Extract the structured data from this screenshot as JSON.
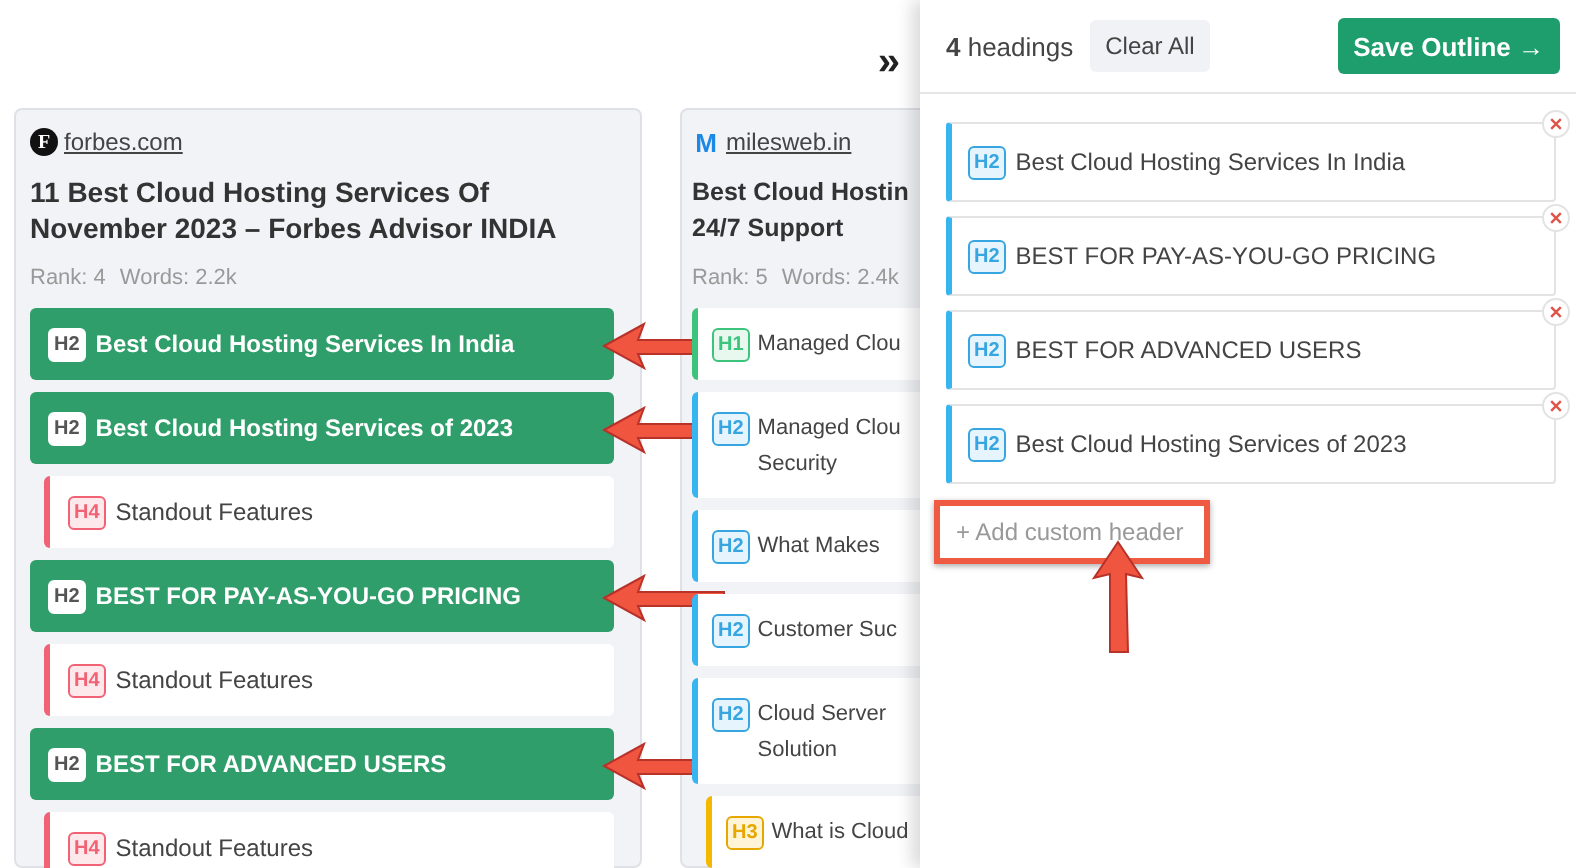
{
  "expand_control": "»",
  "columns": [
    {
      "site": "forbes.com",
      "logo": "F",
      "title": "11 Best Cloud Hosting Services Of November 2023 – Forbes Advisor INDIA",
      "rank": "Rank: 4",
      "words": "Words: 2.2k",
      "headings": [
        {
          "tag": "H2",
          "kind": "h2",
          "lines": [
            "Best Cloud Hosting Services In India"
          ],
          "selected": true,
          "arrow": true
        },
        {
          "tag": "H2",
          "kind": "h2",
          "lines": [
            "Best Cloud Hosting Services of 2023"
          ],
          "selected": true,
          "arrow": true
        },
        {
          "tag": "H4",
          "kind": "h4",
          "lines": [
            "Standout Features"
          ],
          "selected": false,
          "arrow": false
        },
        {
          "tag": "H2",
          "kind": "h2",
          "lines": [
            "BEST FOR PAY-AS-YOU-GO PRICING"
          ],
          "selected": true,
          "arrow": true
        },
        {
          "tag": "H4",
          "kind": "h4",
          "lines": [
            "Standout Features"
          ],
          "selected": false,
          "arrow": false
        },
        {
          "tag": "H2",
          "kind": "h2",
          "lines": [
            "BEST FOR ADVANCED USERS"
          ],
          "selected": true,
          "arrow": true
        },
        {
          "tag": "H4",
          "kind": "h4",
          "lines": [
            "Standout Features"
          ],
          "selected": false,
          "arrow": false
        }
      ]
    },
    {
      "site": "milesweb.in",
      "logo": "M",
      "title_lines": [
        "Best Cloud Hostin",
        "24/7 Support"
      ],
      "rank": "Rank: 5",
      "words": "Words: 2.4k",
      "headings": [
        {
          "tag": "H1",
          "kind": "h1",
          "lines": [
            "Managed Clou"
          ],
          "selected": false,
          "arrow": false
        },
        {
          "tag": "H2",
          "kind": "h2",
          "lines": [
            "Managed Clou",
            "Security"
          ],
          "selected": false,
          "arrow": false
        },
        {
          "tag": "H2",
          "kind": "h2",
          "lines": [
            "What Makes"
          ],
          "selected": false,
          "arrow": false
        },
        {
          "tag": "H2",
          "kind": "h2",
          "lines": [
            "Customer Suc"
          ],
          "selected": false,
          "arrow": false
        },
        {
          "tag": "H2",
          "kind": "h2",
          "lines": [
            "Cloud Server",
            "Solution"
          ],
          "selected": false,
          "arrow": false
        },
        {
          "tag": "H3",
          "kind": "h3",
          "lines": [
            "What is Cloud"
          ],
          "selected": false,
          "arrow": false
        }
      ]
    }
  ],
  "outline": {
    "count": "4",
    "count_label": "headings",
    "clear_button": "Clear All",
    "save_button": "Save Outline",
    "save_arrow": "→",
    "items": [
      {
        "tag": "H2",
        "kind": "h2",
        "text": "Best Cloud Hosting Services In India"
      },
      {
        "tag": "H2",
        "kind": "h2",
        "text": "BEST FOR PAY-AS-YOU-GO PRICING"
      },
      {
        "tag": "H2",
        "kind": "h2",
        "text": "BEST FOR ADVANCED USERS"
      },
      {
        "tag": "H2",
        "kind": "h2",
        "text": "Best Cloud Hosting Services of 2023"
      }
    ],
    "custom_header": {
      "placeholder": "+ Add custom header",
      "highlighted": true
    }
  }
}
